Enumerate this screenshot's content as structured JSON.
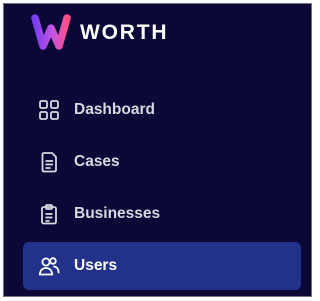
{
  "brand": {
    "name": "WORTH",
    "logo_icon": "worth-w-gradient-logo",
    "colors": [
      "#7b3df0",
      "#c455e0",
      "#ff4f8b"
    ]
  },
  "nav": {
    "items": [
      {
        "label": "Dashboard",
        "icon": "grid-icon",
        "active": false
      },
      {
        "label": "Cases",
        "icon": "document-icon",
        "active": false
      },
      {
        "label": "Businesses",
        "icon": "clipboard-icon",
        "active": false
      },
      {
        "label": "Users",
        "icon": "users-icon",
        "active": true
      }
    ]
  },
  "theme": {
    "sidebar_bg": "#0b0838",
    "active_bg": "#22328a",
    "text": "#d7d8e0",
    "active_text": "#ffffff"
  }
}
